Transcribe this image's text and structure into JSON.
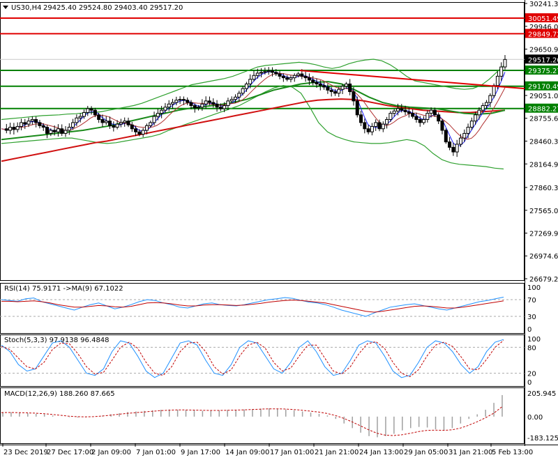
{
  "header": {
    "symbol": "US30,H4",
    "ohlc": "29425.40 29524.80 29403.40 29517.20"
  },
  "panels": {
    "rsi_label": "RSI(14) 75.9171 ->MA(9) 67.1022",
    "stoch_label": "Stoch(5,3,3) 97.9138 96.4848",
    "macd_label": "MACD(12,26,9) 188.260 87.665"
  },
  "price_axis_ticks": [
    "30241.35",
    "29946.00",
    "29650.95",
    "29355.60",
    "29051.00",
    "28755.65",
    "28460.30",
    "28164.95",
    "27860.35",
    "27565.00",
    "27269.95",
    "26974.60",
    "26679.25"
  ],
  "rsi_axis_ticks": [
    "100",
    "70",
    "30",
    "0"
  ],
  "stoch_axis_ticks": [
    "100",
    "80",
    "20",
    "0"
  ],
  "macd_axis_ticks": [
    "205.945",
    "0.00",
    "-183.125"
  ],
  "time_axis_labels": [
    "23 Dec 2019",
    "27 Dec 17:00",
    "2 Jan 09:00",
    "7 Jan 01:00",
    "9 Jan 17:00",
    "14 Jan 09:00",
    "17 Jan 01:00",
    "21 Jan 21:00",
    "24 Jan 13:00",
    "29 Jan 05:00",
    "31 Jan 21:00",
    "5 Feb 13:00"
  ],
  "levels": [
    {
      "label": "30051.49",
      "value": 30051.49,
      "color": "#e00000"
    },
    {
      "label": "29849.72",
      "value": 29849.72,
      "color": "#e00000"
    },
    {
      "label": "29517.20",
      "value": 29517.2,
      "color": "#ffffff"
    },
    {
      "label": "29375.27",
      "value": 29375.27,
      "color": "#008000"
    },
    {
      "label": "29170.49",
      "value": 29170.49,
      "color": "#008000"
    },
    {
      "label": "28882.27",
      "value": 28882.27,
      "color": "#008000"
    }
  ],
  "colors": {
    "candle": "#000000",
    "bollinger": "#2ea02e",
    "ma_fast": "#1a1aff",
    "ma_slow": "#d01010",
    "trend_red": "#e00000",
    "trend_green": "#008000",
    "rsi_line": "#1e90ff",
    "signal": "#c00000"
  },
  "chart_data": {
    "type": "candlestick",
    "symbol": "US30",
    "timeframe": "H4",
    "y_range": [
      26679.25,
      30241.35
    ],
    "last_close": 29517.2,
    "x_labels": [
      "23 Dec 2019",
      "27 Dec 17:00",
      "2 Jan 09:00",
      "7 Jan 01:00",
      "9 Jan 17:00",
      "14 Jan 09:00",
      "17 Jan 01:00",
      "21 Jan 21:00",
      "24 Jan 13:00",
      "29 Jan 05:00",
      "31 Jan 21:00",
      "5 Feb 13:00"
    ],
    "close_path": [
      28620,
      28600,
      28640,
      28610,
      28650,
      28700,
      28680,
      28720,
      28740,
      28700,
      28660,
      28640,
      28560,
      28600,
      28580,
      28620,
      28560,
      28600,
      28640,
      28700,
      28760,
      28780,
      28830,
      28880,
      28860,
      28800,
      28740,
      28700,
      28720,
      28660,
      28640,
      28680,
      28700,
      28720,
      28670,
      28620,
      28580,
      28550,
      28600,
      28660,
      28700,
      28780,
      28820,
      28860,
      28900,
      28940,
      28960,
      28990,
      29000,
      28990,
      28960,
      28920,
      28890,
      28900,
      28940,
      28980,
      28960,
      28940,
      28900,
      28880,
      28920,
      28980,
      29000,
      29030,
      29080,
      29140,
      29200,
      29260,
      29310,
      29340,
      29350,
      29360,
      29370,
      29350,
      29330,
      29300,
      29280,
      29260,
      29280,
      29310,
      29330,
      29300,
      29280,
      29250,
      29220,
      29200,
      29180,
      29160,
      29120,
      29100,
      29080,
      29130,
      29170,
      29200,
      29100,
      28980,
      28800,
      28700,
      28620,
      28580,
      28650,
      28700,
      28620,
      28680,
      28740,
      28820,
      28850,
      28880,
      28860,
      28840,
      28820,
      28780,
      28740,
      28700,
      28740,
      28820,
      28860,
      28800,
      28720,
      28600,
      28450,
      28380,
      28320,
      28420,
      28500,
      28560,
      28640,
      28720,
      28800,
      28860,
      28920,
      28960,
      29050,
      29180,
      29300,
      29420,
      29517
    ],
    "bollinger_upper_path": [
      28740,
      28750,
      28760,
      28770,
      28780,
      28790,
      28795,
      28800,
      28810,
      28815,
      28825,
      28830,
      28840,
      28860,
      28880,
      28900,
      28920,
      28950,
      28990,
      29030,
      29070,
      29110,
      29150,
      29190,
      29210,
      29230,
      29250,
      29270,
      29300,
      29340,
      29380,
      29420,
      29440,
      29450,
      29460,
      29470,
      29480,
      29470,
      29450,
      29420,
      29400,
      29420,
      29460,
      29490,
      29510,
      29520,
      29500,
      29450,
      29380,
      29300,
      29240,
      29220,
      29200,
      29180,
      29160,
      29140,
      29130,
      29140,
      29180,
      29260,
      29360,
      29460
    ],
    "bollinger_lower_path": [
      28430,
      28440,
      28450,
      28460,
      28470,
      28480,
      28490,
      28500,
      28500,
      28480,
      28460,
      28440,
      28430,
      28440,
      28460,
      28480,
      28500,
      28520,
      28550,
      28600,
      28640,
      28680,
      28720,
      28760,
      28800,
      28840,
      28880,
      28920,
      28980,
      29040,
      29100,
      29150,
      29180,
      29160,
      29080,
      28900,
      28700,
      28580,
      28520,
      28480,
      28450,
      28440,
      28430,
      28430,
      28440,
      28460,
      28480,
      28460,
      28400,
      28300,
      28220,
      28180,
      28160,
      28150,
      28140,
      28130,
      28110,
      28100
    ],
    "ma_red_path": [
      28200,
      28230,
      28260,
      28290,
      28320,
      28350,
      28380,
      28410,
      28440,
      28460,
      28490,
      28520,
      28550,
      28580,
      28610,
      28640,
      28670,
      28700,
      28730,
      28760,
      28790,
      28820,
      28850,
      28880,
      28910,
      28940,
      28970,
      28990,
      29000,
      29005,
      29000,
      28980,
      28950,
      28920,
      28900,
      28880,
      28860,
      28850,
      28840,
      28830,
      28830,
      28840,
      28850,
      28860
    ],
    "ma_green_path": [
      28480,
      28500,
      28520,
      28540,
      28560,
      28580,
      28600,
      28630,
      28660,
      28700,
      28740,
      28780,
      28820,
      28860,
      28890,
      28910,
      28930,
      28960,
      29000,
      29060,
      29120,
      29160,
      29200,
      29220,
      29230,
      29200,
      29120,
      29030,
      28960,
      28920,
      28900,
      28890,
      28880,
      28850,
      28820,
      28810,
      28820,
      28860
    ],
    "levels": [
      30051.49,
      29849.72,
      29375.27,
      29170.49,
      28882.27
    ],
    "trendline_red": {
      "from": 29375,
      "to": 29140
    },
    "rsi": {
      "period": 14,
      "value": 75.9171,
      "ma_period": 9,
      "ma_value": 67.1022,
      "range": [
        0,
        100
      ],
      "guides": [
        70,
        30
      ],
      "path": [
        70,
        68,
        66,
        72,
        74,
        65,
        60,
        55,
        50,
        45,
        52,
        58,
        62,
        55,
        48,
        52,
        58,
        65,
        70,
        68,
        62,
        58,
        52,
        50,
        55,
        60,
        62,
        58,
        56,
        55,
        58,
        62,
        66,
        70,
        72,
        75,
        73,
        68,
        64,
        62,
        58,
        52,
        45,
        40,
        35,
        30,
        38,
        45,
        52,
        55,
        58,
        60,
        56,
        52,
        48,
        45,
        50,
        55,
        60,
        65,
        68,
        72,
        76
      ],
      "ma_path": [
        66,
        66,
        65,
        66,
        67,
        65,
        62,
        58,
        55,
        52,
        52,
        54,
        56,
        55,
        53,
        52,
        54,
        58,
        62,
        63,
        62,
        60,
        57,
        55,
        55,
        57,
        58,
        58,
        57,
        56,
        57,
        59,
        61,
        64,
        66,
        68,
        69,
        68,
        66,
        64,
        62,
        58,
        54,
        50,
        46,
        42,
        40,
        42,
        45,
        48,
        51,
        54,
        55,
        54,
        52,
        50,
        50,
        52,
        55,
        58,
        61,
        64,
        67
      ]
    },
    "stochastic": {
      "k_period": 5,
      "d": 3,
      "slowing": 3,
      "k": 97.9138,
      "d_value": 96.4848,
      "range": [
        0,
        100
      ],
      "guides": [
        80,
        20
      ],
      "k_path": [
        85,
        70,
        40,
        25,
        30,
        60,
        90,
        95,
        80,
        50,
        20,
        15,
        30,
        70,
        95,
        90,
        60,
        25,
        10,
        20,
        55,
        90,
        95,
        85,
        50,
        20,
        15,
        40,
        80,
        95,
        90,
        60,
        30,
        20,
        45,
        80,
        95,
        70,
        35,
        15,
        20,
        50,
        85,
        95,
        90,
        60,
        25,
        10,
        15,
        45,
        80,
        95,
        90,
        70,
        40,
        20,
        35,
        70,
        92,
        98
      ],
      "d_path": [
        82,
        75,
        55,
        35,
        30,
        45,
        75,
        90,
        88,
        65,
        35,
        18,
        22,
        50,
        80,
        92,
        78,
        45,
        20,
        15,
        35,
        70,
        90,
        92,
        70,
        35,
        18,
        28,
        60,
        85,
        92,
        78,
        45,
        25,
        32,
        60,
        85,
        85,
        55,
        25,
        18,
        35,
        65,
        88,
        93,
        78,
        45,
        20,
        12,
        28,
        60,
        85,
        92,
        82,
        58,
        30,
        28,
        52,
        80,
        96
      ]
    },
    "macd": {
      "fast": 12,
      "slow": 26,
      "signal": 9,
      "value": 188.26,
      "signal_value": 87.665,
      "range": [
        -183.125,
        205.945
      ],
      "hist_path": [
        40,
        38,
        35,
        30,
        25,
        20,
        10,
        0,
        -5,
        -8,
        -6,
        0,
        10,
        20,
        30,
        40,
        45,
        50,
        55,
        60,
        62,
        60,
        58,
        55,
        50,
        52,
        55,
        58,
        60,
        62,
        65,
        70,
        72,
        68,
        62,
        55,
        45,
        35,
        25,
        10,
        -20,
        -60,
        -100,
        -140,
        -170,
        -180,
        -170,
        -150,
        -120,
        -100,
        -90,
        -95,
        -110,
        -120,
        -100,
        -60,
        -20,
        20,
        60,
        120,
        188
      ],
      "signal_path": [
        35,
        36,
        35,
        33,
        30,
        26,
        20,
        12,
        5,
        0,
        -2,
        0,
        5,
        12,
        20,
        28,
        34,
        40,
        46,
        52,
        56,
        58,
        58,
        57,
        55,
        54,
        54,
        55,
        57,
        59,
        62,
        65,
        68,
        68,
        66,
        62,
        56,
        48,
        40,
        28,
        10,
        -15,
        -45,
        -80,
        -115,
        -145,
        -162,
        -165,
        -158,
        -145,
        -130,
        -120,
        -118,
        -120,
        -115,
        -100,
        -75,
        -45,
        -10,
        30,
        87.665
      ]
    }
  }
}
